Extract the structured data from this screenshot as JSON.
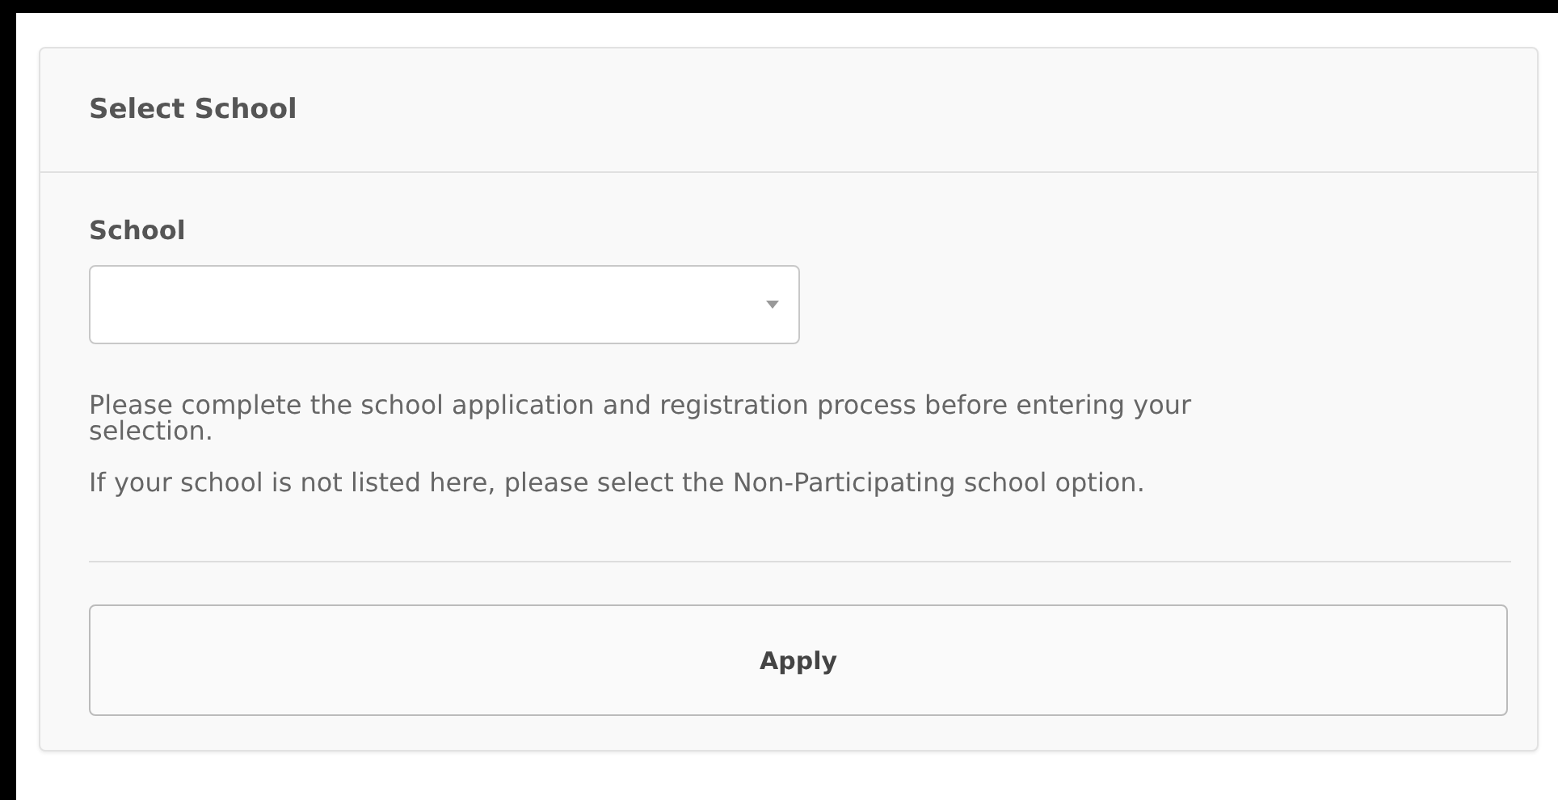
{
  "card": {
    "title": "Select School"
  },
  "field": {
    "label": "School"
  },
  "notes": [
    "Please complete the school application and registration process before entering your selection.",
    "If your school is not listed here, please select the Non-Participating school option."
  ],
  "button": {
    "label": "Apply"
  }
}
